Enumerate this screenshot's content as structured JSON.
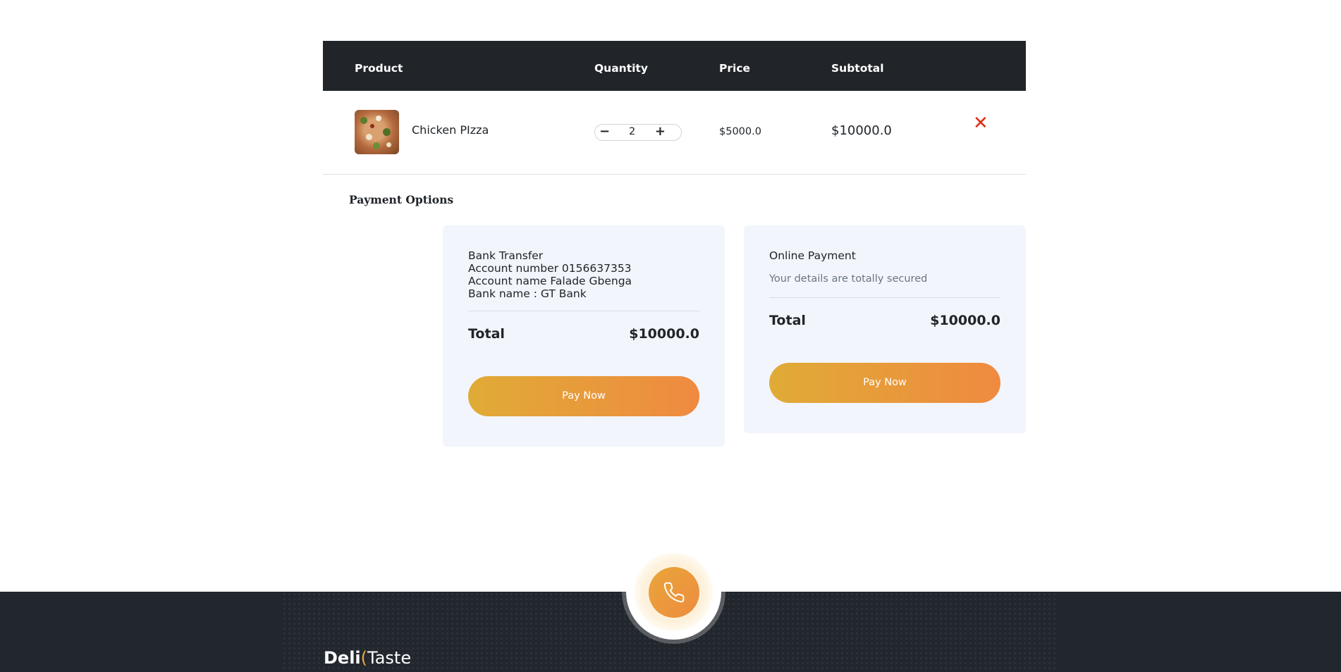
{
  "cart": {
    "headers": {
      "product": "Product",
      "quantity": "Quantity",
      "price": "Price",
      "subtotal": "Subtotal"
    },
    "items": [
      {
        "name": "Chicken PIzza",
        "quantity": "2",
        "price": "$5000.0",
        "subtotal": "$10000.0"
      }
    ],
    "remove_symbol": "✕",
    "minus_symbol": "−",
    "plus_symbol": "+"
  },
  "payment": {
    "title": "Payment Options",
    "bank": {
      "line1": "Bank Transfer",
      "line2": "Account number 0156637353",
      "line3": "Account name Falade Gbenga",
      "line4": "Bank name : GT Bank",
      "total_label": "Total",
      "total_value": "$10000.0",
      "button": "Pay Now"
    },
    "online": {
      "title": "Online Payment",
      "subtitle": "Your details are totally secured",
      "total_label": "Total",
      "total_value": "$10000.0",
      "button": "Pay Now"
    }
  },
  "footer": {
    "logo_deli": "Deli",
    "logo_taste": "Taste",
    "phone_icon": "phone-icon"
  },
  "colors": {
    "header_bg": "#212529",
    "remove": "#dc2d12",
    "button_gradient_start": "#e0ab36",
    "button_gradient_end": "#ef8a40",
    "card_bg": "#f2f5fc",
    "footer_bg": "#22262d"
  }
}
